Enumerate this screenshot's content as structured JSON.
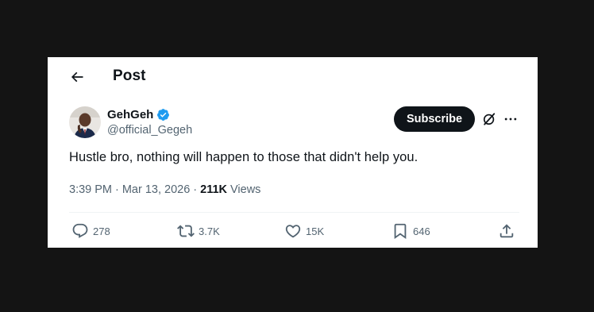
{
  "header": {
    "back_icon": "arrow-left-icon",
    "title": "Post"
  },
  "author": {
    "display_name": "GehGeh",
    "handle": "@official_Gegeh",
    "verified_icon": "verified-badge-icon",
    "verified_color": "#1d9bf0"
  },
  "toolbar": {
    "subscribe_label": "Subscribe",
    "grok_icon": "grok-icon",
    "more_icon": "more-horizontal-icon"
  },
  "post": {
    "text": "Hustle bro, nothing will happen to those that didn't help you.",
    "time": "3:39 PM",
    "separator": "·",
    "date": "Mar 13, 2026",
    "views_count": "211K",
    "views_label": "Views"
  },
  "actions": {
    "replies": {
      "icon": "reply-icon",
      "count": "278"
    },
    "reposts": {
      "icon": "repost-icon",
      "count": "3.7K"
    },
    "likes": {
      "icon": "heart-icon",
      "count": "15K"
    },
    "bookmarks": {
      "icon": "bookmark-icon",
      "count": "646"
    },
    "share": {
      "icon": "share-icon"
    }
  },
  "colors": {
    "background": "#141414",
    "card": "#ffffff",
    "text_primary": "#0f1419",
    "text_secondary": "#536471",
    "button_dark": "#0f1419"
  }
}
